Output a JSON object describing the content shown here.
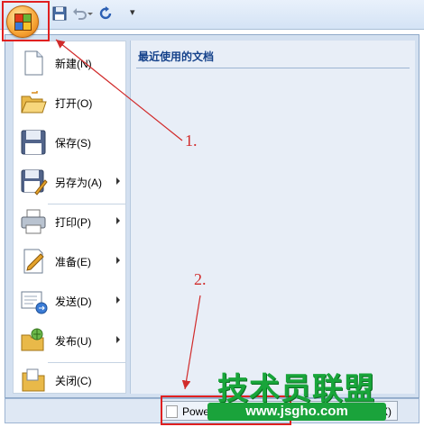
{
  "recent_documents": {
    "title": "最近使用的文档"
  },
  "menu": {
    "items": [
      {
        "label": "新建(N)",
        "icon": "new-document-icon",
        "submenu": false
      },
      {
        "label": "打开(O)",
        "icon": "open-folder-icon",
        "submenu": false
      },
      {
        "label": "保存(S)",
        "icon": "save-disk-icon",
        "submenu": false
      },
      {
        "label": "另存为(A)",
        "icon": "save-as-icon",
        "submenu": true
      },
      {
        "label": "打印(P)",
        "icon": "printer-icon",
        "submenu": true
      },
      {
        "label": "准备(E)",
        "icon": "prepare-icon",
        "submenu": true
      },
      {
        "label": "发送(D)",
        "icon": "send-icon",
        "submenu": true
      },
      {
        "label": "发布(U)",
        "icon": "publish-icon",
        "submenu": true
      },
      {
        "label": "关闭(C)",
        "icon": "close-folder-icon",
        "submenu": false
      }
    ]
  },
  "bottom_bar": {
    "options_label": "Power",
    "exit_label": "oint(X)"
  },
  "annotations": {
    "step1": "1.",
    "step2": "2."
  },
  "watermark": {
    "title": "技术员联盟",
    "url": "www.jsgho.com"
  },
  "colors": {
    "highlight_box": "#e02020",
    "annotation": "#d12b2b",
    "watermark": "#18a53a"
  }
}
